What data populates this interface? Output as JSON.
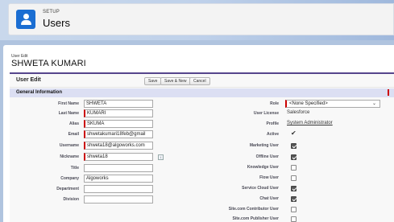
{
  "setup": {
    "eyebrow": "SETUP",
    "title": "Users"
  },
  "user": {
    "eyebrow": "User Edit",
    "name": "SHWETA KUMARI"
  },
  "edit": {
    "title": "User Edit",
    "buttons": {
      "save": "Save",
      "save_new": "Save & New",
      "cancel": "Cancel"
    },
    "section": "General Information"
  },
  "left_fields": {
    "first_name": {
      "label": "First Name",
      "value": "SHWETA"
    },
    "last_name": {
      "label": "Last Name",
      "value": "KUMARI"
    },
    "alias": {
      "label": "Alias",
      "value": "SKUMA"
    },
    "email": {
      "label": "Email",
      "value": "shwetakumari18feb@gmail"
    },
    "username": {
      "label": "Username",
      "value": "shweta18@algoworks.com"
    },
    "nickname": {
      "label": "Nickname",
      "value": "shweta18",
      "info": "i"
    },
    "title": {
      "label": "Title",
      "value": ""
    },
    "company": {
      "label": "Company",
      "value": "Algoworks"
    },
    "department": {
      "label": "Department",
      "value": ""
    },
    "division": {
      "label": "Division",
      "value": ""
    }
  },
  "right_fields": {
    "role": {
      "label": "Role",
      "value": "<None Specified>"
    },
    "user_license": {
      "label": "User License",
      "value": "Salesforce"
    },
    "profile": {
      "label": "Profile",
      "value": "System Administrator"
    },
    "active": {
      "label": "Active",
      "value": "✔"
    },
    "marketing_user": {
      "label": "Marketing User",
      "checked": true
    },
    "offline_user": {
      "label": "Offline User",
      "checked": true
    },
    "knowledge_user": {
      "label": "Knowledge User",
      "checked": false
    },
    "flow_user": {
      "label": "Flow User",
      "checked": false
    },
    "service_cloud_user": {
      "label": "Service Cloud User",
      "checked": true
    },
    "chat_user": {
      "label": "Chat User",
      "checked": true
    },
    "site_contributor": {
      "label": "Site.com Contributor User",
      "checked": false
    },
    "site_publisher": {
      "label": "Site.com Publisher User",
      "checked": false
    }
  },
  "colors": {
    "accent": "#1b6ed2",
    "required": "#cc0000",
    "section_bar": "#dcdff3",
    "header_rule": "#56458c"
  },
  "icons": {
    "app": "user-icon",
    "lookup": "info-icon",
    "dropdown": "chevron-down-icon"
  }
}
